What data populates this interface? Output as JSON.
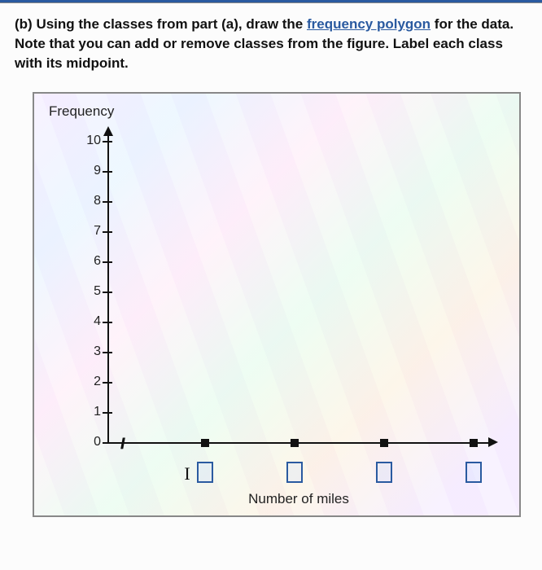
{
  "question": {
    "label": "(b)",
    "text_pre": "Using the classes from part (a), draw the ",
    "link_text": "frequency polygon",
    "text_post": " for the data. Note that you can add or remove classes from the figure. Label each class with its midpoint."
  },
  "chart_data": {
    "type": "line",
    "title": "",
    "ylabel": "Frequency",
    "xlabel": "Number of miles",
    "ylim": [
      0,
      10
    ],
    "yticks": [
      0,
      1,
      2,
      3,
      4,
      5,
      6,
      7,
      8,
      9,
      10
    ],
    "categories": [
      "",
      "",
      "",
      ""
    ],
    "values": [
      0,
      0,
      0,
      0
    ],
    "x_slots": 4,
    "x_editable": true
  }
}
